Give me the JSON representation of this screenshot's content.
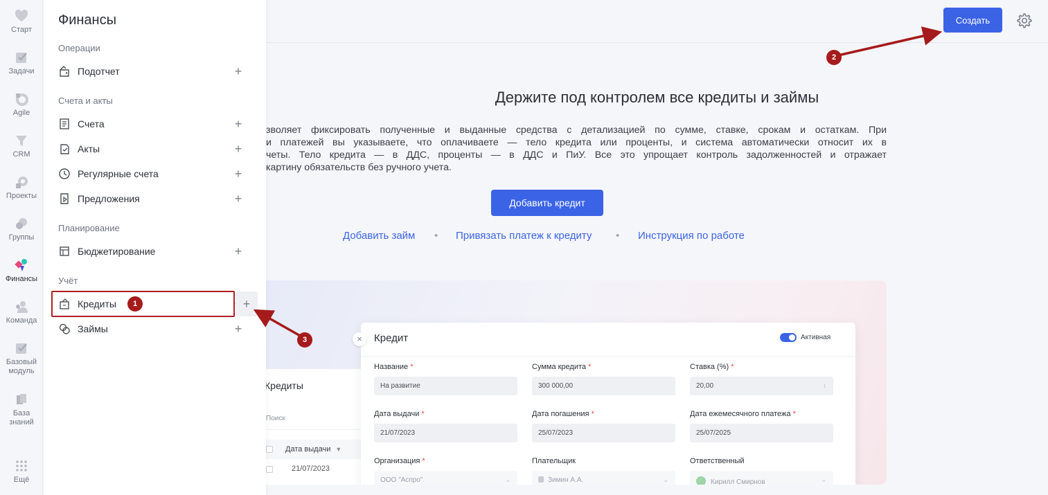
{
  "rail": {
    "items": [
      {
        "label": "Старт",
        "icon": "heart-icon"
      },
      {
        "label": "Задачи",
        "icon": "tasks-icon"
      },
      {
        "label": "Agile",
        "icon": "agile-icon"
      },
      {
        "label": "CRM",
        "icon": "crm-icon"
      },
      {
        "label": "Проекты",
        "icon": "projects-icon"
      },
      {
        "label": "Группы",
        "icon": "groups-icon"
      },
      {
        "label": "Финансы",
        "icon": "finance-icon"
      },
      {
        "label": "Команда",
        "icon": "team-icon"
      },
      {
        "label": "Базовый модуль",
        "icon": "base-module-icon"
      },
      {
        "label": "База знаний",
        "icon": "knowledge-base-icon"
      },
      {
        "label": "Ещё",
        "icon": "more-grid-icon"
      }
    ]
  },
  "menu": {
    "title": "Финансы",
    "sections": {
      "operations": "Операции",
      "accounts": "Счета и акты",
      "planning": "Планирование",
      "accounting": "Учёт"
    },
    "items": {
      "podotchet": "Подотчет",
      "scheta": "Счета",
      "akty": "Акты",
      "regular": "Регулярные счета",
      "offers": "Предложения",
      "budget": "Бюджетирование",
      "credits": "Кредиты",
      "loans": "Займы"
    },
    "plus": "+"
  },
  "topbar": {
    "create_label": "Создать"
  },
  "main": {
    "title": "Держите под контролем все кредиты и займы",
    "description_lines": [
      "зволяет фиксировать полученные и выданные средства с детализацией по сумме, ставке, срокам и остаткам. При",
      "и платежей вы указываете, что оплачиваете — тело кредита или проценты, и система автоматически относит их в",
      "четы. Тело кредита — в ДДС, проценты — в ДДС и ПиУ. Все это упрощает контроль задолженностей и отражает",
      "картину обязательств без ручного учета."
    ],
    "add_credit_label": "Добавить кредит",
    "links": {
      "add_loan": "Добавить займ",
      "link_payment": "Привязать платеж к кредиту",
      "instructions": "Инструкция по работе",
      "separator": "•"
    }
  },
  "preview": {
    "list": {
      "title": "Кредиты",
      "search_placeholder": "Поиск",
      "column_header": "Дата выдачи",
      "row_value": "21/07/2023"
    },
    "form": {
      "title": "Кредит",
      "close": "×",
      "toggle_label": "Активная",
      "required_mark": "*",
      "fields": {
        "name_label": "Название",
        "name_value": "На развитие",
        "amount_label": "Сумма кредита",
        "amount_value": "300 000,00",
        "rate_label": "Ставка (%)",
        "rate_value": "20,00",
        "issue_label": "Дата выдачи",
        "issue_value": "21/07/2023",
        "repay_label": "Дата погашения",
        "repay_value": "25/07/2023",
        "monthly_label": "Дата ежемесячного платежа",
        "monthly_value": "25/07/2025",
        "org_label": "Организация",
        "org_value": "ООО \"Аспро\"",
        "payer_label": "Плательщик",
        "payer_value": "Зимин А.А.",
        "resp_label": "Ответственный",
        "resp_value": "Кирилл Смирнов"
      }
    }
  },
  "annotations": {
    "badge1": "1",
    "badge2": "2",
    "badge3": "3",
    "color": "#a51b1b"
  },
  "colors": {
    "accent": "#3b63e6",
    "annotation": "#a51b1b"
  }
}
